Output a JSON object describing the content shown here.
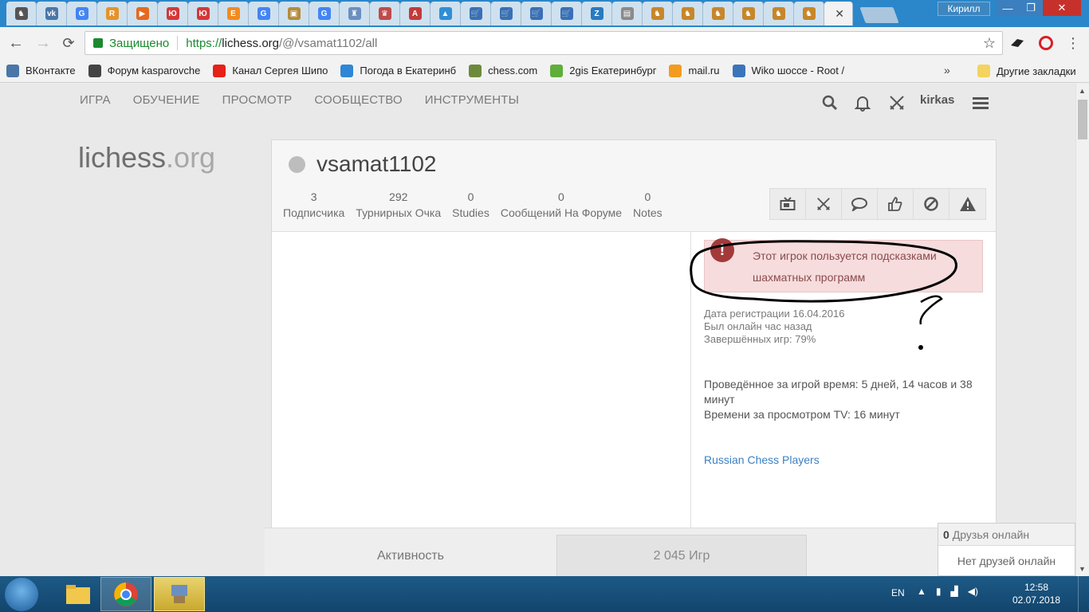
{
  "browser": {
    "tabs": [
      {
        "icon": "lichess-icon",
        "color": "#555555",
        "glyph": "♞"
      },
      {
        "icon": "vk-icon",
        "color": "#4a76a8",
        "glyph": "vk"
      },
      {
        "icon": "google-icon",
        "color": "#4285f4",
        "glyph": "G"
      },
      {
        "icon": "app-icon",
        "color": "#e5932b",
        "glyph": "R"
      },
      {
        "icon": "video-icon",
        "color": "#e56a1f",
        "glyph": "▶"
      },
      {
        "icon": "yu-icon",
        "color": "#d43838",
        "glyph": "Ю"
      },
      {
        "icon": "yu-icon",
        "color": "#d43838",
        "glyph": "Ю"
      },
      {
        "icon": "e-icon",
        "color": "#f28b1e",
        "glyph": "E"
      },
      {
        "icon": "google-icon",
        "color": "#4285f4",
        "glyph": "G"
      },
      {
        "icon": "archive-icon",
        "color": "#b38b3c",
        "glyph": "▣"
      },
      {
        "icon": "google-icon",
        "color": "#4285f4",
        "glyph": "G"
      },
      {
        "icon": "chair-icon",
        "color": "#6a8fc0",
        "glyph": "♜"
      },
      {
        "icon": "piece-icon",
        "color": "#c04a4a",
        "glyph": "♛"
      },
      {
        "icon": "a-icon",
        "color": "#c23b3b",
        "glyph": "A"
      },
      {
        "icon": "triangle-icon",
        "color": "#2f8ed6",
        "glyph": "▲"
      },
      {
        "icon": "cart-icon",
        "color": "#3a6fb8",
        "glyph": "🛒"
      },
      {
        "icon": "cart-icon",
        "color": "#3a6fb8",
        "glyph": "🛒"
      },
      {
        "icon": "cart-icon",
        "color": "#3a6fb8",
        "glyph": "🛒"
      },
      {
        "icon": "cart-icon",
        "color": "#3a6fb8",
        "glyph": "🛒"
      },
      {
        "icon": "z-icon",
        "color": "#2a7abf",
        "glyph": "Z"
      },
      {
        "icon": "doc-icon",
        "color": "#8a8a8a",
        "glyph": "▤"
      },
      {
        "icon": "chess-piece-icon",
        "color": "#c7862a",
        "glyph": "♞"
      },
      {
        "icon": "chess-piece-icon",
        "color": "#c7862a",
        "glyph": "♞"
      },
      {
        "icon": "chess-piece-icon",
        "color": "#c7862a",
        "glyph": "♞"
      },
      {
        "icon": "chess-piece-icon",
        "color": "#c7862a",
        "glyph": "♞"
      },
      {
        "icon": "chess-piece-icon",
        "color": "#c7862a",
        "glyph": "♞"
      },
      {
        "icon": "chess-piece-icon",
        "color": "#c7862a",
        "glyph": "♞"
      }
    ],
    "active_tab_close": "✕",
    "profile_user": "Кирилл",
    "secure_label": "Защищено",
    "url_scheme": "https://",
    "url_host": "lichess.org",
    "url_path": "/@/vsamat1102/all",
    "bookmarks": [
      {
        "label": "ВКонтакте",
        "icon": "vk-icon",
        "color": "#4a76a8"
      },
      {
        "label": "Форум kasparovche",
        "icon": "knight-icon",
        "color": "#444444"
      },
      {
        "label": "Канал Сергея Шипо",
        "icon": "youtube-icon",
        "color": "#e62117"
      },
      {
        "label": "Погода в Екатеринб",
        "icon": "drop-icon",
        "color": "#2e86d6"
      },
      {
        "label": "chess.com",
        "icon": "pawn-icon",
        "color": "#6d8a3a"
      },
      {
        "label": "2gis Екатеринбург",
        "icon": "2gis-icon",
        "color": "#5fae3a"
      },
      {
        "label": "mail.ru",
        "icon": "at-icon",
        "color": "#f29b1f"
      },
      {
        "label": "Wiko шоссе - Root /",
        "icon": "network-icon",
        "color": "#3b74b8"
      }
    ],
    "bookmarks_more": "»",
    "other_bookmarks": "Другие закладки"
  },
  "site": {
    "nav": [
      "ИГРА",
      "ОБУЧЕНИЕ",
      "ПРОСМОТР",
      "СООБЩЕСТВО",
      "ИНСТРУМЕНТЫ"
    ],
    "username": "kirkas",
    "logo_main": "lichess",
    "logo_tld": ".org"
  },
  "profile": {
    "name": "vsamat1102",
    "stats": [
      {
        "num": "3",
        "label": "Подписчика"
      },
      {
        "num": "292",
        "label": "Турнирных Очка"
      },
      {
        "num": "0",
        "label": "Studies"
      },
      {
        "num": "0",
        "label": "Сообщений На Форуме"
      },
      {
        "num": "0",
        "label": "Notes"
      }
    ],
    "cheat_warning": "Этот игрок пользуется подсказками шахматных программ",
    "cheat_icon": "!",
    "registered": "Дата регистрации 16.04.2016",
    "last_seen": "Был онлайн час назад",
    "completion": "Завершённых игр: 79%",
    "play_time": "Проведённое за игрой время: 5 дней, 14 часов и 38 минут",
    "tv_time": "Времени за просмотром TV: 16 минут",
    "team": "Russian Chess Players"
  },
  "subtabs": {
    "activity": "Активность",
    "games": "2 045 Игр"
  },
  "friends": {
    "count": "0",
    "label": "Друзья онлайн",
    "empty": "Нет друзей онлайн"
  },
  "taskbar": {
    "lang": "EN",
    "time": "12:58",
    "date": "02.07.2018"
  },
  "colors": {
    "accent_blue": "#2b87c9",
    "secure_green": "#1b8a2e",
    "warning_red": "#a33a3a",
    "link_blue": "#3b7fc4"
  }
}
